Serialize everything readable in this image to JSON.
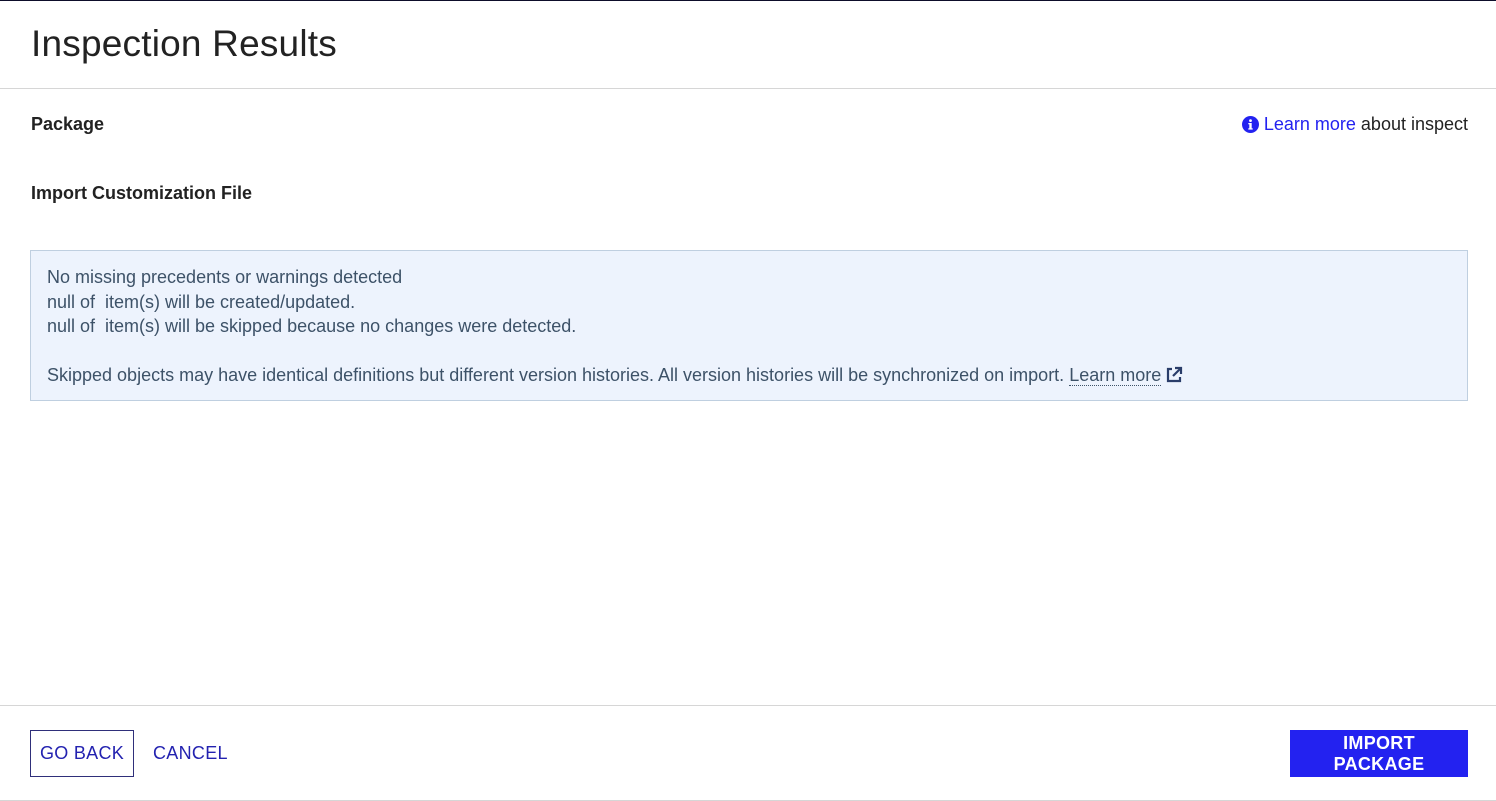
{
  "header": {
    "title": "Inspection Results"
  },
  "package": {
    "label": "Package"
  },
  "import_section": {
    "label": "Import Customization File"
  },
  "learn_more_top": {
    "link_text": "Learn more",
    "suffix": "about inspect"
  },
  "info_box": {
    "line1": "No missing precedents or warnings detected",
    "line2": "null of  item(s) will be created/updated.",
    "line3": "null of  item(s) will be skipped because no changes were detected.",
    "skip_note": "Skipped objects may have identical definitions but different version histories. All version histories will be synchronized on import.",
    "learn_more_link": "Learn more"
  },
  "footer": {
    "go_back_label": "GO BACK",
    "cancel_label": "CANCEL",
    "import_label": "IMPORT PACKAGE"
  },
  "colors": {
    "accent": "#2322f0",
    "info_bg": "#edf3fd",
    "info_text": "#3d5268"
  },
  "icons": {
    "info": "info-circle-icon",
    "external": "external-link-icon"
  }
}
